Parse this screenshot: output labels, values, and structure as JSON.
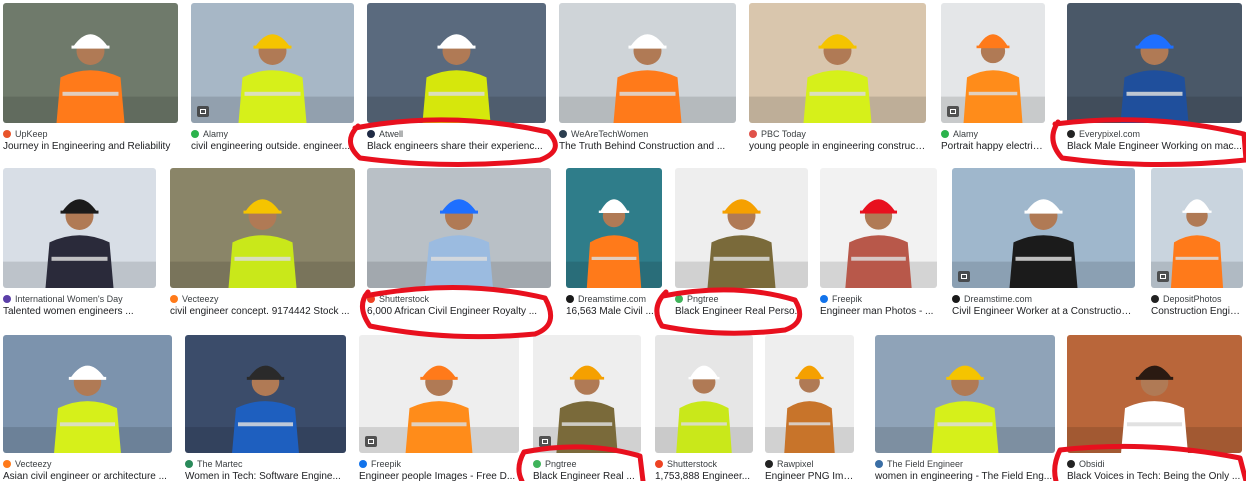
{
  "colors": {
    "annotation": "#e8101e",
    "caption_text": "#202124",
    "source_text": "#3c4043"
  },
  "results": [
    {
      "source": "UpKeep",
      "caption": "Journey in Engineering and Reliability",
      "fav": "#e8542a",
      "bg": "#6f7a6b",
      "hat": "#ffffff",
      "vest": "#ff7a1a",
      "badge": false
    },
    {
      "source": "Alamy",
      "caption": "civil engineering outside. engineer...",
      "fav": "#2bb24c",
      "bg": "#a7b7c6",
      "hat": "#f5c400",
      "vest": "#d6f01a",
      "badge": true
    },
    {
      "source": "Atwell",
      "caption": "Black engineers share their experienc...",
      "fav": "#1f2a44",
      "bg": "#5a6a7e",
      "hat": "#ffffff",
      "vest": "#d6e70c",
      "badge": false
    },
    {
      "source": "WeAreTechWomen",
      "caption": "The Truth Behind Construction and ...",
      "fav": "#2c3e50",
      "bg": "#cfd4d8",
      "hat": "#ffffff",
      "vest": "#ff7a1a",
      "badge": false
    },
    {
      "source": "PBC Today",
      "caption": "young people in engineering construct...",
      "fav": "#e0524a",
      "bg": "#d9c6ad",
      "hat": "#f5c400",
      "vest": "#d6f01a",
      "badge": false
    },
    {
      "source": "Alamy",
      "caption": "Portrait happy electrica...",
      "fav": "#2bb24c",
      "bg": "#e4e6e8",
      "hat": "#ff7a1a",
      "vest": "#ff8c1a",
      "badge": true
    },
    {
      "source": "Everypixel.com",
      "caption": "Black Male Engineer Working on mac...",
      "fav": "#222222",
      "bg": "#4a5868",
      "hat": "#1e6fff",
      "vest": "#1f4f9c",
      "badge": false
    },
    {
      "source": "International Women's Day",
      "caption": "Talented women engineers ...",
      "fav": "#5b3fa8",
      "bg": "#d8dee6",
      "hat": "#1b1b1b",
      "vest": "#2a2a3a",
      "badge": false
    },
    {
      "source": "Vecteezy",
      "caption": "civil engineer concept. 9174442 Stock ...",
      "fav": "#ff7a1a",
      "bg": "#8a8568",
      "hat": "#f5c400",
      "vest": "#c9e81a",
      "badge": false
    },
    {
      "source": "Shutterstock",
      "caption": "6,000 African Civil Engineer Royalty ...",
      "fav": "#ee4323",
      "bg": "#b9c0c6",
      "hat": "#1e6fff",
      "vest": "#9bbbe0",
      "badge": false
    },
    {
      "source": "Dreamstime.com",
      "caption": "16,563 Male Civil ...",
      "fav": "#1a1a1a",
      "bg": "#2f7d8a",
      "hat": "#ffffff",
      "vest": "#ff7a1a",
      "badge": false
    },
    {
      "source": "Pngtree",
      "caption": "Black Engineer Real Perso...",
      "fav": "#3fb35a",
      "bg": "#eeeeee",
      "hat": "#f5a000",
      "vest": "#7a6a3a",
      "badge": false
    },
    {
      "source": "Freepik",
      "caption": "Engineer man Photos - ...",
      "fav": "#1273eb",
      "bg": "#f2f2f2",
      "hat": "#e8101e",
      "vest": "#b8584a",
      "badge": false
    },
    {
      "source": "Dreamstime.com",
      "caption": "Civil Engineer Worker at a Construction...",
      "fav": "#1a1a1a",
      "bg": "#9fb7cc",
      "hat": "#ffffff",
      "vest": "#1b1b1b",
      "badge": true
    },
    {
      "source": "DepositPhotos",
      "caption": "Construction Engin...",
      "fav": "#222222",
      "bg": "#c9d4de",
      "hat": "#ffffff",
      "vest": "#ff7a1a",
      "badge": true
    },
    {
      "source": "Vecteezy",
      "caption": "Asian civil engineer or architecture ...",
      "fav": "#ff7a1a",
      "bg": "#7c93ad",
      "hat": "#ffffff",
      "vest": "#d6f01a",
      "badge": false
    },
    {
      "source": "The Martec",
      "caption": "Women in Tech: Software Engine...",
      "fav": "#2a8a5a",
      "bg": "#3b4c6a",
      "hat": "#2a2a2a",
      "vest": "#1e5fbf",
      "badge": false
    },
    {
      "source": "Freepik",
      "caption": "Engineer people Images - Free D...",
      "fav": "#1273eb",
      "bg": "#eeeeee",
      "hat": "#ff7a1a",
      "vest": "#ff8c1a",
      "badge": true
    },
    {
      "source": "Pngtree",
      "caption": "Black Engineer Real ...",
      "fav": "#3fb35a",
      "bg": "#eeeeee",
      "hat": "#f5a000",
      "vest": "#7a6a3a",
      "badge": true
    },
    {
      "source": "Shutterstock",
      "caption": "1,753,888 Engineer...",
      "fav": "#ee4323",
      "bg": "#e6e6e6",
      "hat": "#ffffff",
      "vest": "#c9e81a",
      "badge": false
    },
    {
      "source": "Rawpixel",
      "caption": "Engineer PNG Ima...",
      "fav": "#222222",
      "bg": "#eeeeee",
      "hat": "#f5a000",
      "vest": "#c8742a",
      "badge": false
    },
    {
      "source": "The Field Engineer",
      "caption": "women in engineering - The Field Eng...",
      "fav": "#3a6ea5",
      "bg": "#8fa3b8",
      "hat": "#f5c400",
      "vest": "#d6f01a",
      "badge": false
    },
    {
      "source": "Obsidi",
      "caption": "Black Voices in Tech: Being the Only ...",
      "fav": "#222222",
      "bg": "#b9663a",
      "hat": "#2a1a12",
      "vest": "#ffffff",
      "badge": false
    }
  ]
}
